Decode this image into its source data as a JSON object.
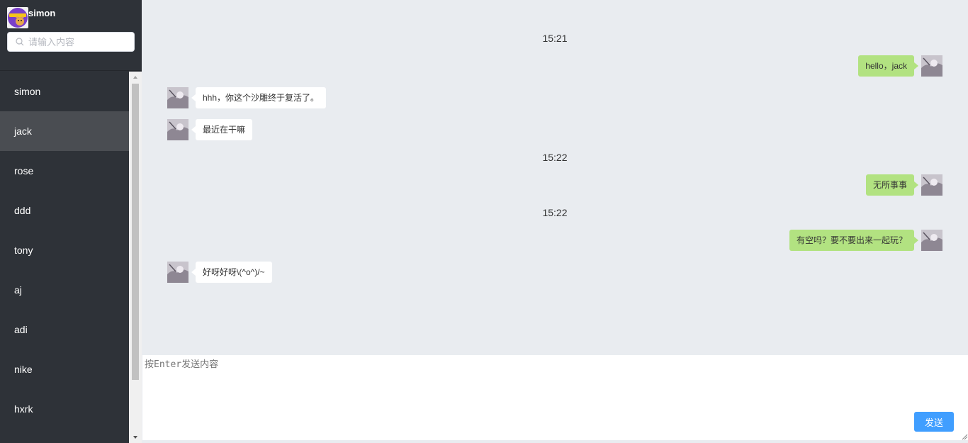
{
  "user": {
    "name": "simon"
  },
  "search": {
    "placeholder": "请输入内容",
    "value": ""
  },
  "contacts": [
    {
      "name": "simon",
      "active": false
    },
    {
      "name": "jack",
      "active": true
    },
    {
      "name": "rose",
      "active": false
    },
    {
      "name": "ddd",
      "active": false
    },
    {
      "name": "tony",
      "active": false
    },
    {
      "name": "aj",
      "active": false
    },
    {
      "name": "adi",
      "active": false
    },
    {
      "name": "nike",
      "active": false
    },
    {
      "name": "hxrk",
      "active": false
    }
  ],
  "messages": [
    {
      "type": "time",
      "text": "15:21"
    },
    {
      "type": "self",
      "text": "hello，jack"
    },
    {
      "type": "other",
      "text": "hhh，你这个沙雕终于复活了。"
    },
    {
      "type": "other",
      "text": "最近在干嘛"
    },
    {
      "type": "time",
      "text": "15:22"
    },
    {
      "type": "self",
      "text": "无所事事"
    },
    {
      "type": "time",
      "text": "15:22"
    },
    {
      "type": "self",
      "text": "有空吗？要不要出来一起玩？"
    },
    {
      "type": "other",
      "text": "好呀好呀\\(^o^)/~"
    }
  ],
  "composer": {
    "placeholder": "按Enter发送内容",
    "value": "",
    "send_label": "发送"
  },
  "colors": {
    "sidebar": "#2e3238",
    "active_item": "#4a4d52",
    "chat_bg": "#e9ecf0",
    "self_bubble": "#b2e281",
    "other_bubble": "#ffffff",
    "send_button": "#409eff"
  }
}
